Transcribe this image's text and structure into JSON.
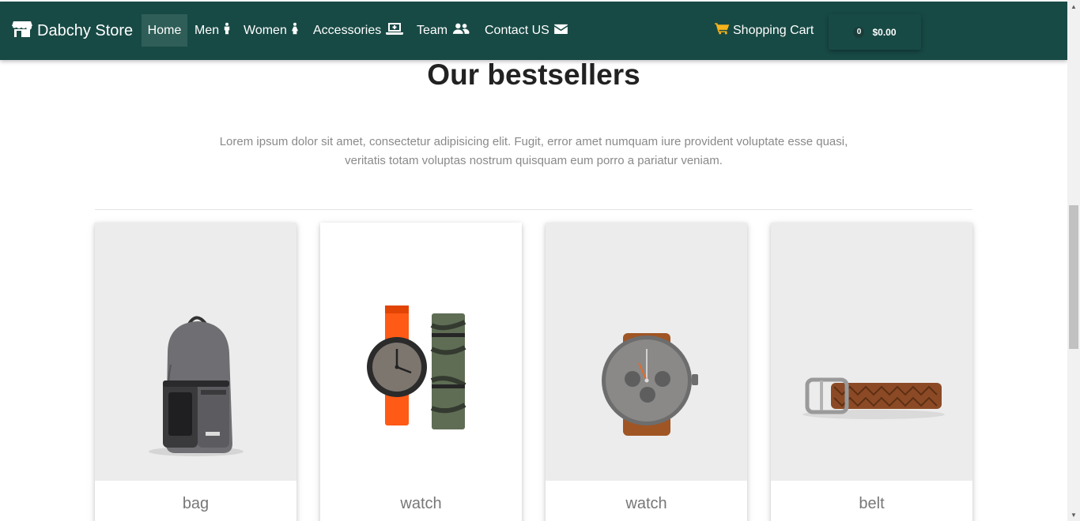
{
  "nav": {
    "brand": "Dabchy Store",
    "items": [
      {
        "label": "Home",
        "icon": "",
        "active": true
      },
      {
        "label": "Men",
        "icon": "male-icon"
      },
      {
        "label": "Women",
        "icon": "female-icon"
      },
      {
        "label": "Accessories",
        "icon": "laptop-medical-icon"
      },
      {
        "label": "Team",
        "icon": "users-icon"
      },
      {
        "label": "Contact US",
        "icon": "envelope-icon"
      }
    ],
    "cart_label": "Shopping Cart",
    "cart_count": "0",
    "cart_total": "$0.00"
  },
  "main": {
    "title": "Our bestsellers",
    "lead": "Lorem ipsum dolor sit amet, consectetur adipisicing elit. Fugit, error amet numquam iure provident voluptate esse quasi, veritatis totam voluptas nostrum quisquam eum porro a pariatur veniam.",
    "products": [
      {
        "label": "bag",
        "image": "backpack"
      },
      {
        "label": "watch",
        "image": "watch-with-straps"
      },
      {
        "label": "watch",
        "image": "chronograph-watch"
      },
      {
        "label": "belt",
        "image": "braided-belt"
      }
    ]
  },
  "colors": {
    "navbar": "#184a45",
    "cart_icon": "#f6b31a",
    "active_nav": "#2f5e58"
  }
}
